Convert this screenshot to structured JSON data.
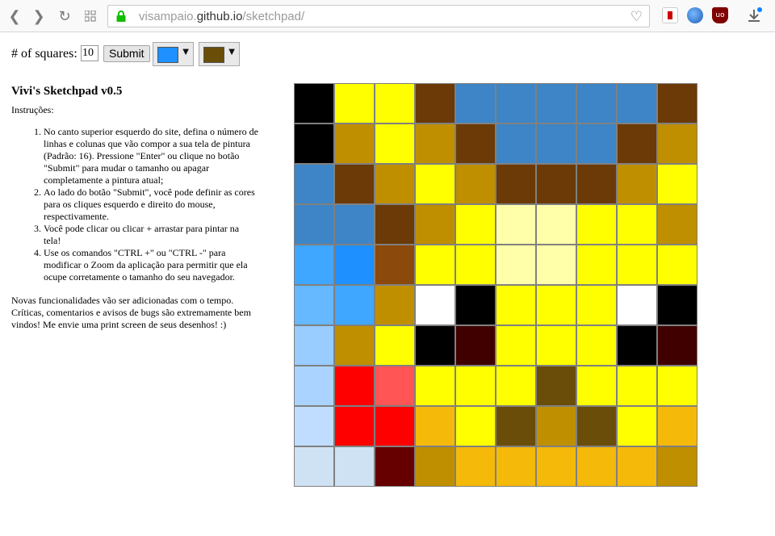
{
  "browser": {
    "url_host": "visampaio.",
    "url_domain": "github.io",
    "url_path": "/sketchpad/"
  },
  "controls": {
    "squares_label": "# of squares:",
    "squares_value": "10",
    "submit_label": "Submit",
    "left_color": "#1e90ff",
    "right_color": "#6b4d0a"
  },
  "info": {
    "title": "Vivi's Sketchpad v0.5",
    "instructions_label": "Instruções:",
    "steps": [
      "No canto superior esquerdo do site, defina o número de linhas e colunas que vão compor a sua tela de pintura (Padrão: 16). Pressione \"Enter\" ou clique no botão \"Submit\" para mudar o tamanho ou apagar completamente a pintura atual;",
      "Ao lado do botão \"Submit\", você pode definir as cores para os cliques esquerdo e direito do mouse, respectivamente.",
      "Você pode clicar ou clicar + arrastar para pintar na tela!",
      "Use os comandos \"CTRL +\" ou \"CTRL -\" para modificar o Zoom da aplicação para permitir que ela ocupe corretamente o tamanho do seu navegador."
    ],
    "footer": "Novas funcionalidades vão ser adicionadas com o tempo. Críticas, comentarios e avisos de bugs são extremamente bem vindos! Me envie uma print screen de seus desenhos! :)"
  },
  "grid": {
    "size": 10,
    "cells": [
      [
        "#000000",
        "#ffff00",
        "#ffff00",
        "#6b3a06",
        "#3d85c6",
        "#3d85c6",
        "#3d85c6",
        "#3d85c6",
        "#3d85c6",
        "#6b3a06"
      ],
      [
        "#000000",
        "#bf8f00",
        "#ffff00",
        "#bf8f00",
        "#6b3a06",
        "#3d85c6",
        "#3d85c6",
        "#3d85c6",
        "#6b3a06",
        "#bf8f00"
      ],
      [
        "#3d85c6",
        "#6b3a06",
        "#bf8f00",
        "#ffff00",
        "#bf8f00",
        "#6b3a06",
        "#6b3a06",
        "#6b3a06",
        "#bf8f00",
        "#ffff00"
      ],
      [
        "#3d85c6",
        "#3d85c6",
        "#6b3a06",
        "#bf8f00",
        "#ffff00",
        "#ffffaa",
        "#ffffaa",
        "#ffff00",
        "#ffff00",
        "#bf8f00"
      ],
      [
        "#3fa7ff",
        "#1e90ff",
        "#8b4a0b",
        "#ffff00",
        "#ffff00",
        "#ffffaa",
        "#ffffaa",
        "#ffff00",
        "#ffff00",
        "#ffff00"
      ],
      [
        "#66b8ff",
        "#3fa7ff",
        "#bf8f00",
        "#ffffff",
        "#000000",
        "#ffff00",
        "#ffff00",
        "#ffff00",
        "#ffffff",
        "#000000"
      ],
      [
        "#99ccff",
        "#bf8f00",
        "#ffff00",
        "#000000",
        "#400000",
        "#ffff00",
        "#ffff00",
        "#ffff00",
        "#000000",
        "#400000"
      ],
      [
        "#aad4ff",
        "#ff0000",
        "#ff5555",
        "#ffff00",
        "#ffff00",
        "#ffff00",
        "#6b4d0a",
        "#ffff00",
        "#ffff00",
        "#ffff00"
      ],
      [
        "#c0ddff",
        "#ff0000",
        "#ff0000",
        "#f5b90a",
        "#ffff00",
        "#6b4d0a",
        "#bf8f00",
        "#6b4d0a",
        "#ffff00",
        "#f5b90a"
      ],
      [
        "#cfe2f3",
        "#cfe2f3",
        "#660000",
        "#bf8f00",
        "#f5b90a",
        "#f5b90a",
        "#f5b90a",
        "#f5b90a",
        "#f5b90a",
        "#bf8f00"
      ]
    ]
  }
}
